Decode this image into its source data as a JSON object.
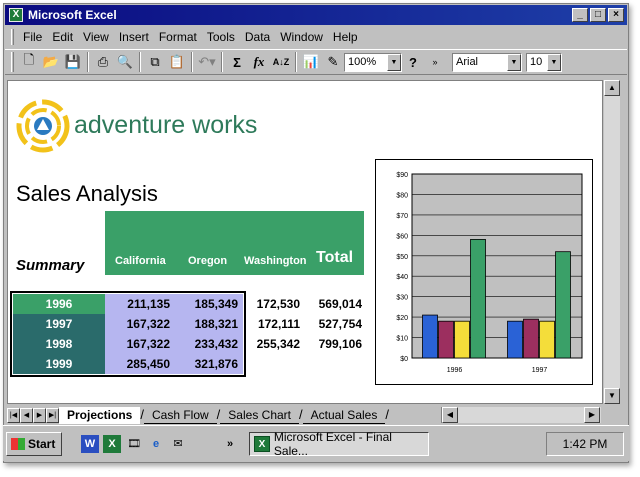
{
  "window": {
    "title": "Microsoft Excel"
  },
  "menu": [
    "File",
    "Edit",
    "View",
    "Insert",
    "Format",
    "Tools",
    "Data",
    "Window",
    "Help"
  ],
  "toolbar": {
    "zoom": "100%",
    "font": "Arial",
    "size": "10"
  },
  "sheet": {
    "brand": "adventure works",
    "title": "Sales Analysis",
    "summary_label": "Summary",
    "headers": [
      "California",
      "Oregon",
      "Washington"
    ],
    "total_header": "Total",
    "rows": [
      {
        "year": "1996",
        "california": "211,135",
        "oregon": "185,349",
        "washington": "172,530",
        "total": "569,014"
      },
      {
        "year": "1997",
        "california": "167,322",
        "oregon": "188,321",
        "washington": "172,111",
        "total": "527,754"
      },
      {
        "year": "1998",
        "california": "167,322",
        "oregon": "233,432",
        "washington": "255,342",
        "total": "799,106"
      },
      {
        "year": "1999",
        "california": "285,450",
        "oregon": "321,876",
        "washington": "",
        "total": ""
      }
    ]
  },
  "chart_data": {
    "type": "bar",
    "categories": [
      "1996",
      "1997"
    ],
    "series": [
      {
        "color": "#2a62d6",
        "values": [
          21,
          18
        ]
      },
      {
        "color": "#9c2f5f",
        "values": [
          18,
          19
        ]
      },
      {
        "color": "#f4dd3a",
        "values": [
          18,
          18
        ]
      },
      {
        "color": "#3aa068",
        "values": [
          58,
          52
        ]
      }
    ],
    "ylim": [
      0,
      90
    ],
    "yticks": [
      "$0",
      "$10",
      "$20",
      "$30",
      "$40",
      "$50",
      "$60",
      "$70",
      "$80",
      "$90"
    ],
    "grid": true,
    "background": "#c0c0c0"
  },
  "tabs": [
    "Projections",
    "Cash Flow",
    "Sales Chart",
    "Actual Sales"
  ],
  "taskbar": {
    "start": "Start",
    "task": "Microsoft Excel - Final Sale...",
    "clock": "1:42 PM"
  },
  "colors": {
    "accent_green": "#3aa068",
    "year_dark": "#2a6b6b",
    "data_purple": "#b6b6f0",
    "title_bar": "#0a0a80"
  }
}
